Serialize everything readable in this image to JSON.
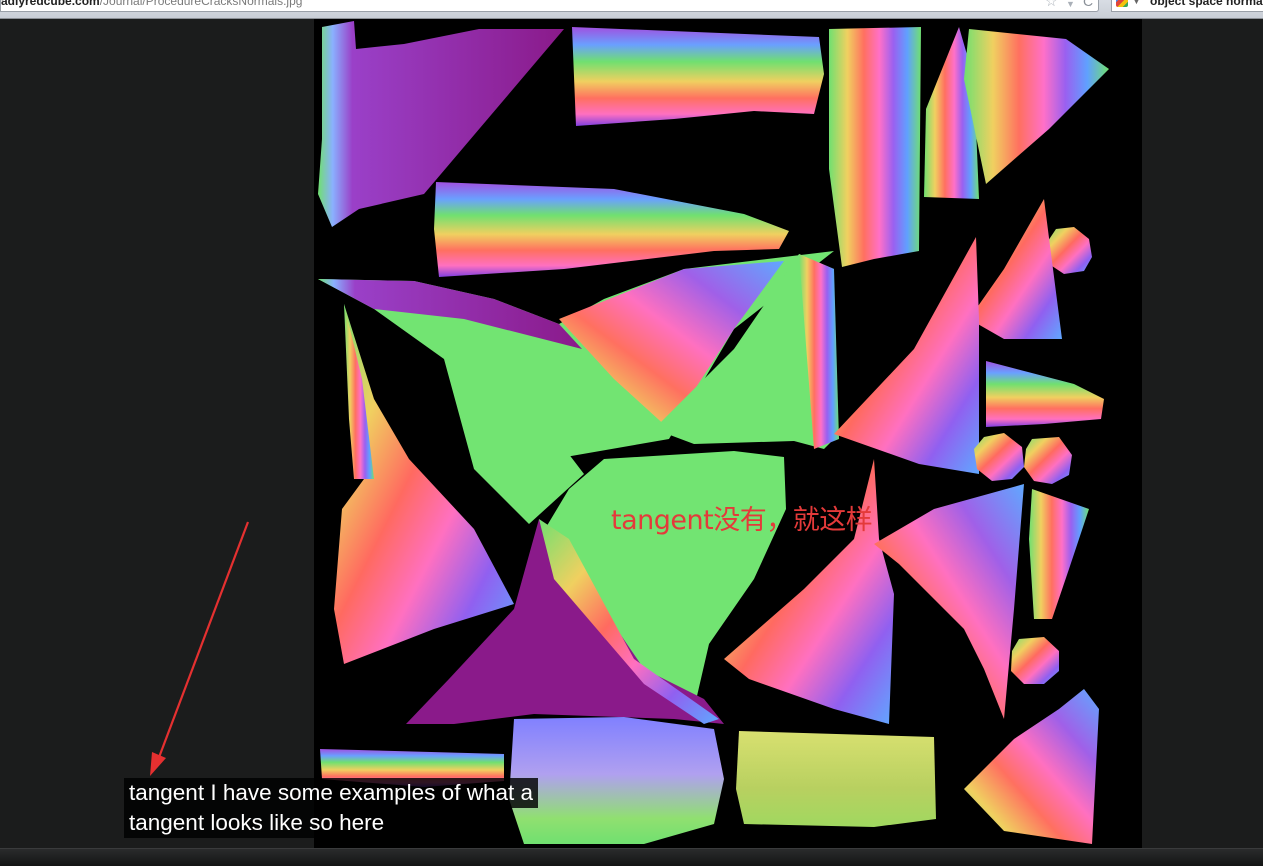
{
  "browser": {
    "url_host": "adiyredcube.com",
    "url_path": "/Journal/ProcedureCracksNormals.jpg",
    "search_text": "object space normal"
  },
  "image": {
    "description_icon": "normal-map-texture",
    "background_color": "#000000"
  },
  "annotation": {
    "text": "tangent没有，就这样",
    "color": "#e43a3a"
  },
  "subtitle": {
    "line1": "tangent I have some examples of what a",
    "line2": "tangent looks like so here"
  }
}
